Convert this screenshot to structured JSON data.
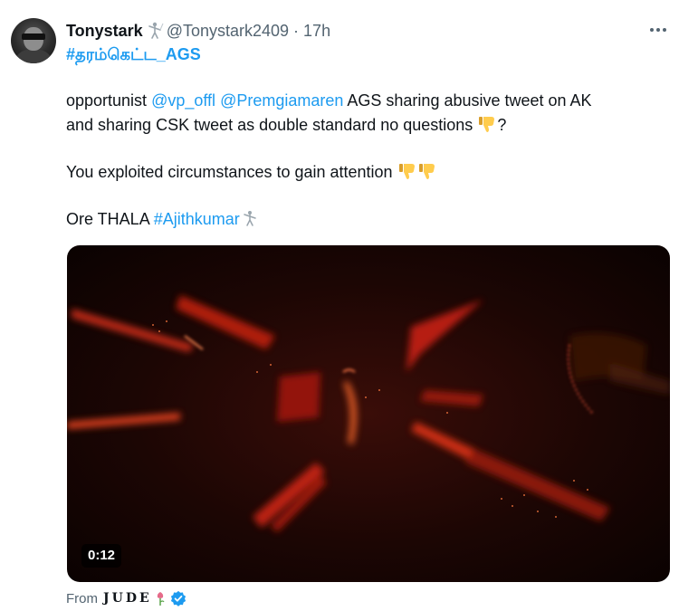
{
  "tweet": {
    "display_name": "Tonystark",
    "handle": "@Tonystark2409",
    "separator": "·",
    "time": "17h",
    "hashtag": "#தரம்கெட்ட_AGS",
    "line1_prefix": "opportunist ",
    "mention1": "@vp_offl",
    "mention2": "@Premgiamaren",
    "line1_suffix": " AGS sharing abusive tweet on AK",
    "line2": "and sharing CSK tweet as double standard no questions ",
    "line2_end": "?",
    "line3": "You exploited circumstances to gain attention ",
    "line4_prefix": "Ore THALA ",
    "hashtag2": "#Ajithkumar",
    "icons": {
      "name_emoji": "fencer-icon",
      "thumbs_down": "thumbs-down-icon",
      "more": "more-icon",
      "verified": "verified-badge-icon"
    }
  },
  "media": {
    "duration": "0:12"
  },
  "attribution": {
    "from_label": "From",
    "source_name": "JUDE"
  },
  "colors": {
    "link": "#1d9bf0",
    "text": "#0f1419",
    "muted": "#536471",
    "emoji_yellow": "#ffcc4d"
  }
}
